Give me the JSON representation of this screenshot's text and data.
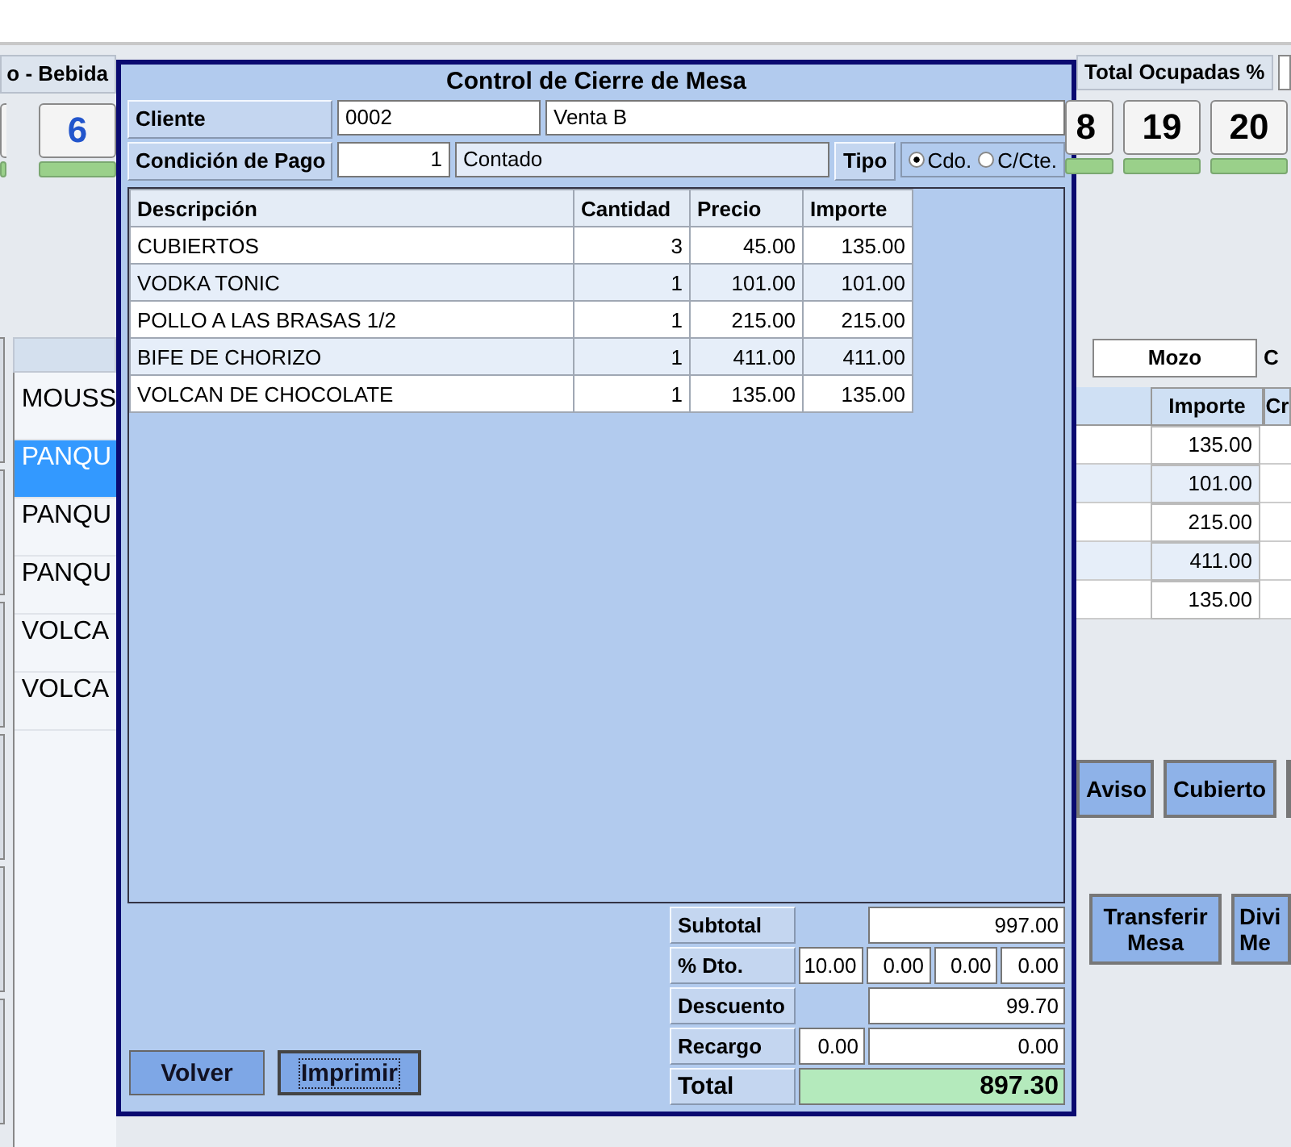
{
  "background": {
    "left_tab": "o - Bebida",
    "left_tables": [
      {
        "label": "6"
      }
    ],
    "items": [
      {
        "label": "MOUSS",
        "selected": false
      },
      {
        "label": "PANQU",
        "selected": true
      },
      {
        "label": "PANQU",
        "selected": false
      },
      {
        "label": "PANQU",
        "selected": false
      },
      {
        "label": "VOLCA",
        "selected": false
      },
      {
        "label": "VOLCA",
        "selected": false
      }
    ],
    "right_tab": "Total Ocupadas %",
    "right_tables": [
      {
        "label": "8"
      },
      {
        "label": "19"
      },
      {
        "label": "20"
      }
    ],
    "mozo": "Mozo",
    "mozo_next": "C",
    "columns": [
      "Importe",
      "Cr"
    ],
    "amounts": [
      "135.00",
      "101.00",
      "215.00",
      "411.00",
      "135.00"
    ],
    "actions": [
      "Aviso",
      "Cubierto"
    ],
    "bottom_actions": [
      "Transferir\nMesa",
      "Divi\nMe"
    ]
  },
  "dialog": {
    "title": "Control de Cierre de Mesa",
    "cliente": {
      "label": "Cliente",
      "code": "0002",
      "name": "Venta B"
    },
    "pago": {
      "label": "Condición de Pago",
      "code": "1",
      "name": "Contado"
    },
    "tipo": {
      "label": "Tipo",
      "options": [
        {
          "label": "Cdo.",
          "selected": true
        },
        {
          "label": "C/Cte.",
          "selected": false
        }
      ]
    },
    "columns": [
      "Descripción",
      "Cantidad",
      "Precio",
      "Importe"
    ],
    "rows": [
      {
        "descripcion": "CUBIERTOS",
        "cantidad": "3",
        "precio": "45.00",
        "importe": "135.00"
      },
      {
        "descripcion": "VODKA TONIC",
        "cantidad": "1",
        "precio": "101.00",
        "importe": "101.00"
      },
      {
        "descripcion": "POLLO A LAS BRASAS 1/2",
        "cantidad": "1",
        "precio": "215.00",
        "importe": "215.00"
      },
      {
        "descripcion": "BIFE DE CHORIZO",
        "cantidad": "1",
        "precio": "411.00",
        "importe": "411.00"
      },
      {
        "descripcion": "VOLCAN DE CHOCOLATE",
        "cantidad": "1",
        "precio": "135.00",
        "importe": "135.00"
      }
    ],
    "totals": {
      "subtotal": {
        "label": "Subtotal",
        "value": "997.00"
      },
      "dto": {
        "label": "% Dto.",
        "values": [
          "10.00",
          "0.00",
          "0.00",
          "0.00"
        ]
      },
      "descuento": {
        "label": "Descuento",
        "value": "99.70"
      },
      "recargo": {
        "label": "Recargo",
        "pct": "0.00",
        "value": "0.00"
      },
      "total": {
        "label": "Total",
        "value": "897.30"
      }
    },
    "buttons": [
      {
        "label": "Volver",
        "focused": false
      },
      {
        "label": "Imprimir",
        "focused": true
      }
    ]
  }
}
